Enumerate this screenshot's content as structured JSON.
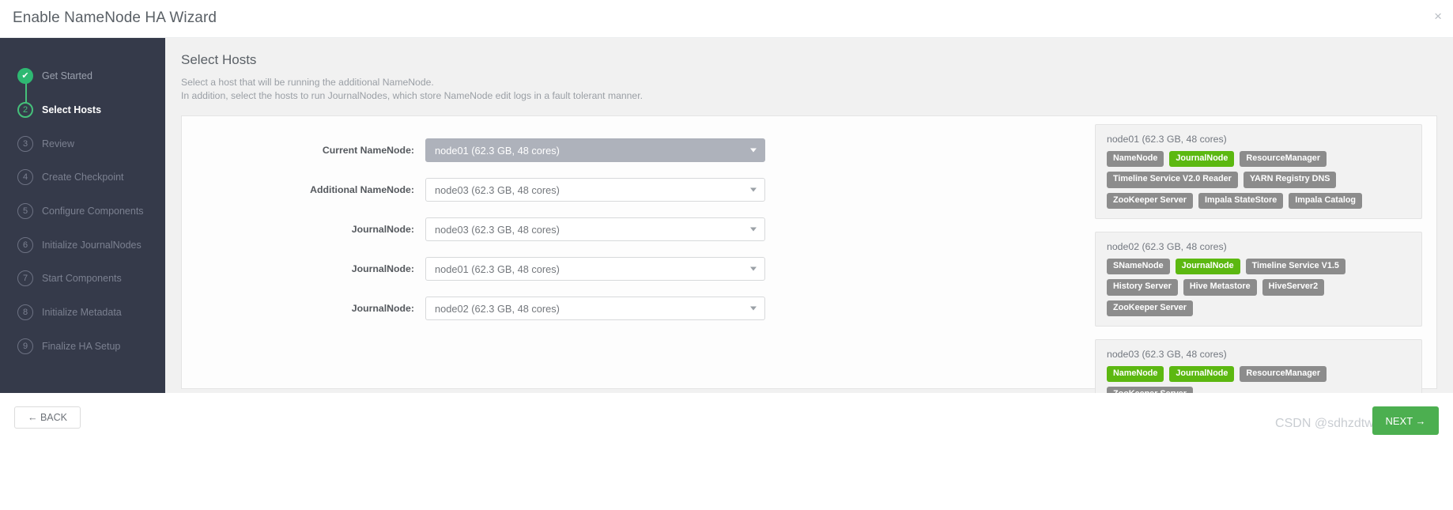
{
  "window": {
    "title": "Enable NameNode HA Wizard",
    "close_icon": "close-icon",
    "close_glyph": "×"
  },
  "sidebar": {
    "steps": [
      {
        "num": "✔",
        "label": "Get Started",
        "state": "done"
      },
      {
        "num": "2",
        "label": "Select Hosts",
        "state": "current"
      },
      {
        "num": "3",
        "label": "Review",
        "state": "todo"
      },
      {
        "num": "4",
        "label": "Create Checkpoint",
        "state": "todo"
      },
      {
        "num": "5",
        "label": "Configure Components",
        "state": "todo"
      },
      {
        "num": "6",
        "label": "Initialize JournalNodes",
        "state": "todo"
      },
      {
        "num": "7",
        "label": "Start Components",
        "state": "todo"
      },
      {
        "num": "8",
        "label": "Initialize Metadata",
        "state": "todo"
      },
      {
        "num": "9",
        "label": "Finalize HA Setup",
        "state": "todo"
      }
    ]
  },
  "main": {
    "title": "Select Hosts",
    "subtitle_line1": "Select a host that will be running the additional NameNode.",
    "subtitle_line2": "In addition, select the hosts to run JournalNodes, which store NameNode edit logs in a fault tolerant manner.",
    "form_rows": [
      {
        "label": "Current NameNode:",
        "value": "node01 (62.3 GB, 48 cores)",
        "disabled": true
      },
      {
        "label": "Additional NameNode:",
        "value": "node03 (62.3 GB, 48 cores)",
        "disabled": false
      },
      {
        "label": "JournalNode:",
        "value": "node03 (62.3 GB, 48 cores)",
        "disabled": false
      },
      {
        "label": "JournalNode:",
        "value": "node01 (62.3 GB, 48 cores)",
        "disabled": false
      },
      {
        "label": "JournalNode:",
        "value": "node02 (62.3 GB, 48 cores)",
        "disabled": false
      }
    ],
    "hosts": [
      {
        "name": "node01 (62.3 GB, 48 cores)",
        "components": [
          {
            "label": "NameNode",
            "highlight": false
          },
          {
            "label": "JournalNode",
            "highlight": true
          },
          {
            "label": "ResourceManager",
            "highlight": false
          },
          {
            "label": "Timeline Service V2.0 Reader",
            "highlight": false
          },
          {
            "label": "YARN Registry DNS",
            "highlight": false
          },
          {
            "label": "ZooKeeper Server",
            "highlight": false
          },
          {
            "label": "Impala StateStore",
            "highlight": false
          },
          {
            "label": "Impala Catalog",
            "highlight": false
          }
        ]
      },
      {
        "name": "node02 (62.3 GB, 48 cores)",
        "components": [
          {
            "label": "SNameNode",
            "highlight": false
          },
          {
            "label": "JournalNode",
            "highlight": true
          },
          {
            "label": "Timeline Service V1.5",
            "highlight": false
          },
          {
            "label": "History Server",
            "highlight": false
          },
          {
            "label": "Hive Metastore",
            "highlight": false
          },
          {
            "label": "HiveServer2",
            "highlight": false
          },
          {
            "label": "ZooKeeper Server",
            "highlight": false
          }
        ]
      },
      {
        "name": "node03 (62.3 GB, 48 cores)",
        "components": [
          {
            "label": "NameNode",
            "highlight": true
          },
          {
            "label": "JournalNode",
            "highlight": true
          },
          {
            "label": "ResourceManager",
            "highlight": false
          },
          {
            "label": "ZooKeeper Server",
            "highlight": false
          }
        ]
      }
    ]
  },
  "footer": {
    "back_label": "← BACK",
    "next_label": "NEXT →",
    "watermark": "CSDN @sdhzdtwhm"
  },
  "colors": {
    "accent_green": "#5cb811",
    "next_green": "#4caf50",
    "sidebar_bg": "#353a4a",
    "badge_gray": "#8c8c8c"
  }
}
